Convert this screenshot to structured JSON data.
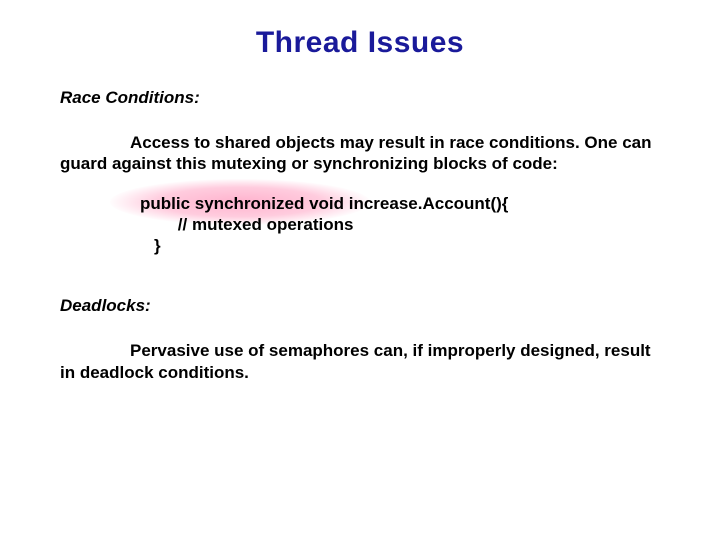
{
  "title": "Thread Issues",
  "section1": {
    "heading": "Race Conditions:",
    "para": "Access to shared objects may result in race conditions.  One can guard against this mutexing or synchronizing blocks of code:"
  },
  "code": {
    "line1": "public synchronized void increase.Account(){",
    "line2": "        // mutexed operations",
    "line3": "}"
  },
  "section2": {
    "heading": "Deadlocks:",
    "para": "Pervasive use of semaphores can, if improperly designed, result in deadlock conditions."
  }
}
